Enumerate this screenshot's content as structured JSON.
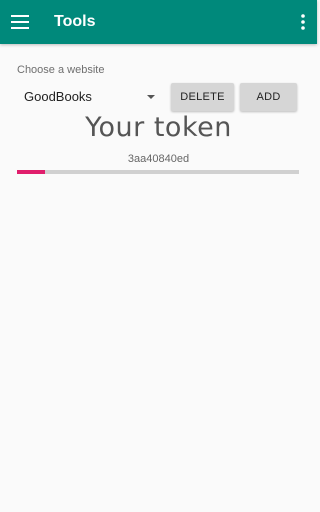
{
  "appbar": {
    "title": "Tools",
    "menu_icon": "hamburger-menu-icon",
    "overflow_icon": "more-vert-icon",
    "color": "#00897b"
  },
  "website_picker": {
    "label": "Choose a website",
    "selected": "GoodBooks"
  },
  "buttons": {
    "delete_label": "DELETE",
    "add_label": "ADD"
  },
  "token_section": {
    "heading": "Your token",
    "token_value": "3aa40840ed",
    "progress_fraction": 0.1,
    "progress_color": "#e01e6c"
  }
}
